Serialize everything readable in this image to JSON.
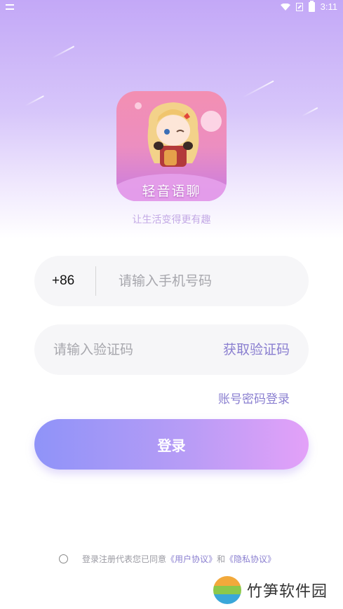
{
  "status_bar": {
    "time": "3:11"
  },
  "app": {
    "logo_text": "轻音语聊",
    "slogan": "让生活变得更有趣"
  },
  "form": {
    "country_code": "+86",
    "phone_placeholder": "请输入手机号码",
    "code_placeholder": "请输入验证码",
    "get_code_label": "获取验证码",
    "password_login_label": "账号密码登录",
    "login_label": "登录"
  },
  "agreement": {
    "prefix": "登录注册代表您已同意",
    "user_agreement": "《用户协议》",
    "and": "和",
    "privacy_agreement": "《隐私协议》"
  },
  "watermark": {
    "text": "竹笋软件园"
  },
  "colors": {
    "accent": "#8a7fd0",
    "button_start": "#8f93f8",
    "button_end": "#e3a1f8"
  }
}
